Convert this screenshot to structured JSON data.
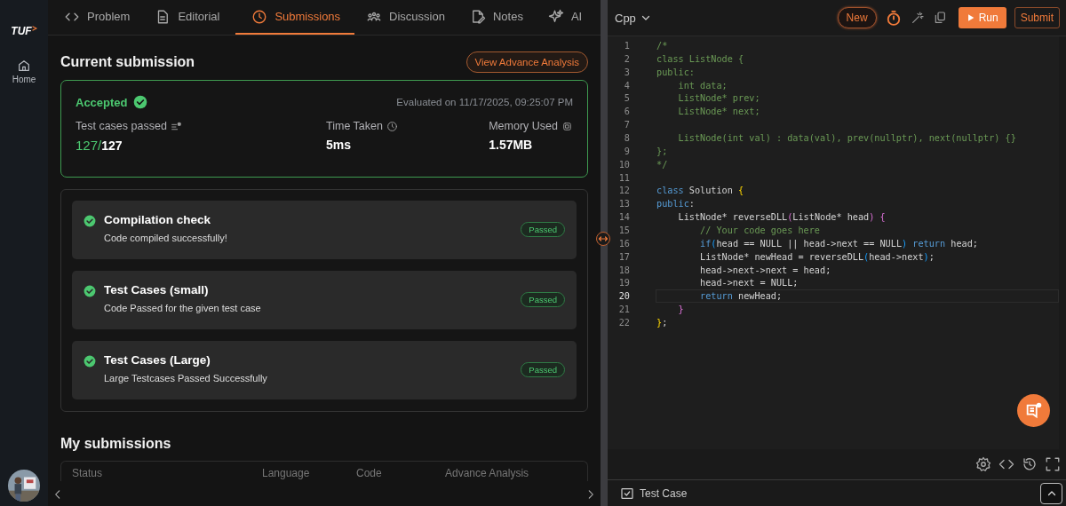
{
  "sidebar": {
    "logo": "TUF",
    "items": [
      {
        "label": "Home",
        "selected": false
      }
    ]
  },
  "tabs": [
    {
      "label": "Problem",
      "selected": false
    },
    {
      "label": "Editorial",
      "selected": false
    },
    {
      "label": "Submissions",
      "selected": true
    },
    {
      "label": "Discussion",
      "selected": false
    },
    {
      "label": "Notes",
      "selected": false
    },
    {
      "label": "AI",
      "selected": false
    }
  ],
  "current_submission": {
    "title": "Current submission",
    "button": "View Advance Analysis",
    "status": "Accepted",
    "evaluated": "Evaluated on 11/17/2025, 09:25:07 PM",
    "stats": [
      {
        "kind": "ratio",
        "label": "Test cases passed",
        "passed": "127/",
        "total": "127"
      },
      {
        "kind": "plain",
        "label": "Time Taken",
        "value": "5ms"
      },
      {
        "kind": "plain",
        "label": "Memory Used",
        "value": "1.57MB"
      }
    ]
  },
  "checks": [
    {
      "title": "Compilation check",
      "detail": "Code compiled successfully!",
      "badge": "Passed",
      "passed": true
    },
    {
      "title": "Test Cases (small)",
      "detail": "Code Passed for the given test case",
      "badge": "Passed",
      "passed": true
    },
    {
      "title": "Test Cases (Large)",
      "detail": "Large Testcases Passed Successfully",
      "badge": "Passed",
      "passed": true
    }
  ],
  "my_submissions": {
    "title": "My submissions",
    "columns": [
      "Status",
      "Language",
      "Code",
      "Advance Analysis"
    ]
  },
  "editor": {
    "language": "Cpp",
    "new_button": "New",
    "run_button": "Run",
    "submit_button": "Submit",
    "lines": [
      {
        "n": "1",
        "current": false,
        "tokens": [
          {
            "text": "/*",
            "kind": "comment"
          }
        ]
      },
      {
        "n": "2",
        "current": false,
        "tokens": [
          {
            "text": "class ListNode {",
            "kind": "comment"
          }
        ]
      },
      {
        "n": "3",
        "current": false,
        "tokens": [
          {
            "text": "public:",
            "kind": "comment"
          }
        ]
      },
      {
        "n": "4",
        "current": false,
        "tokens": [
          {
            "text": "    int data;",
            "kind": "comment"
          }
        ]
      },
      {
        "n": "5",
        "current": false,
        "tokens": [
          {
            "text": "    ListNode* prev;",
            "kind": "comment"
          }
        ]
      },
      {
        "n": "6",
        "current": false,
        "tokens": [
          {
            "text": "    ListNode* next;",
            "kind": "comment"
          }
        ]
      },
      {
        "n": "7",
        "current": false
      },
      {
        "n": "8",
        "current": false,
        "tokens": [
          {
            "text": "    ListNode(int val) : data(val), prev(nullptr), next(nullptr) {}",
            "kind": "comment"
          }
        ]
      },
      {
        "n": "9",
        "current": false,
        "tokens": [
          {
            "text": "};",
            "kind": "comment"
          }
        ]
      },
      {
        "n": "10",
        "current": false,
        "tokens": [
          {
            "text": "*/",
            "kind": "comment"
          }
        ]
      },
      {
        "n": "11",
        "current": false
      },
      {
        "n": "12",
        "current": false,
        "tokens": [
          {
            "text": "class",
            "kind": "keyword"
          },
          {
            "text": " Solution ",
            "kind": "text"
          },
          {
            "text": "{",
            "kind": "bracket1"
          }
        ]
      },
      {
        "n": "13",
        "current": false,
        "tokens": [
          {
            "text": "public",
            "kind": "keyword"
          },
          {
            "text": ":",
            "kind": "text"
          }
        ]
      },
      {
        "n": "14",
        "current": false,
        "tokens": [
          {
            "text": "    ListNode* reverseDLL",
            "kind": "text"
          },
          {
            "text": "(",
            "kind": "bracket2"
          },
          {
            "text": "ListNode* head",
            "kind": "text"
          },
          {
            "text": ")",
            "kind": "bracket2"
          },
          {
            "text": " {",
            "kind": "bracket2"
          }
        ]
      },
      {
        "n": "15",
        "current": false,
        "tokens": [
          {
            "text": "        // Your code goes here",
            "kind": "comment"
          }
        ]
      },
      {
        "n": "16",
        "current": false,
        "tokens": [
          {
            "text": "        if",
            "kind": "keyword"
          },
          {
            "text": "(",
            "kind": "bracket3"
          },
          {
            "text": "head == NULL || head->next == NULL",
            "kind": "text"
          },
          {
            "text": ")",
            "kind": "bracket3"
          },
          {
            "text": " return",
            "kind": "keyword"
          },
          {
            "text": " head;",
            "kind": "text"
          }
        ]
      },
      {
        "n": "17",
        "current": false,
        "tokens": [
          {
            "text": "        ListNode* newHead = reverseDLL",
            "kind": "text"
          },
          {
            "text": "(",
            "kind": "bracket3"
          },
          {
            "text": "head->next",
            "kind": "text"
          },
          {
            "text": ")",
            "kind": "bracket3"
          },
          {
            "text": ";",
            "kind": "text"
          }
        ]
      },
      {
        "n": "18",
        "current": false,
        "tokens": [
          {
            "text": "        head->next->next = head;",
            "kind": "text"
          }
        ]
      },
      {
        "n": "19",
        "current": false,
        "tokens": [
          {
            "text": "        head->next = NULL;",
            "kind": "text"
          }
        ]
      },
      {
        "n": "20",
        "current": true,
        "tokens": [
          {
            "text": "        return",
            "kind": "keyword"
          },
          {
            "text": " newHead;",
            "kind": "text"
          }
        ]
      },
      {
        "n": "21",
        "current": false,
        "tokens": [
          {
            "text": "    }",
            "kind": "bracket2"
          }
        ]
      },
      {
        "n": "22",
        "current": false,
        "tokens": [
          {
            "text": "}",
            "kind": "bracket1"
          },
          {
            "text": ";",
            "kind": "text"
          }
        ]
      }
    ]
  },
  "console": {
    "label": "Test Case"
  }
}
